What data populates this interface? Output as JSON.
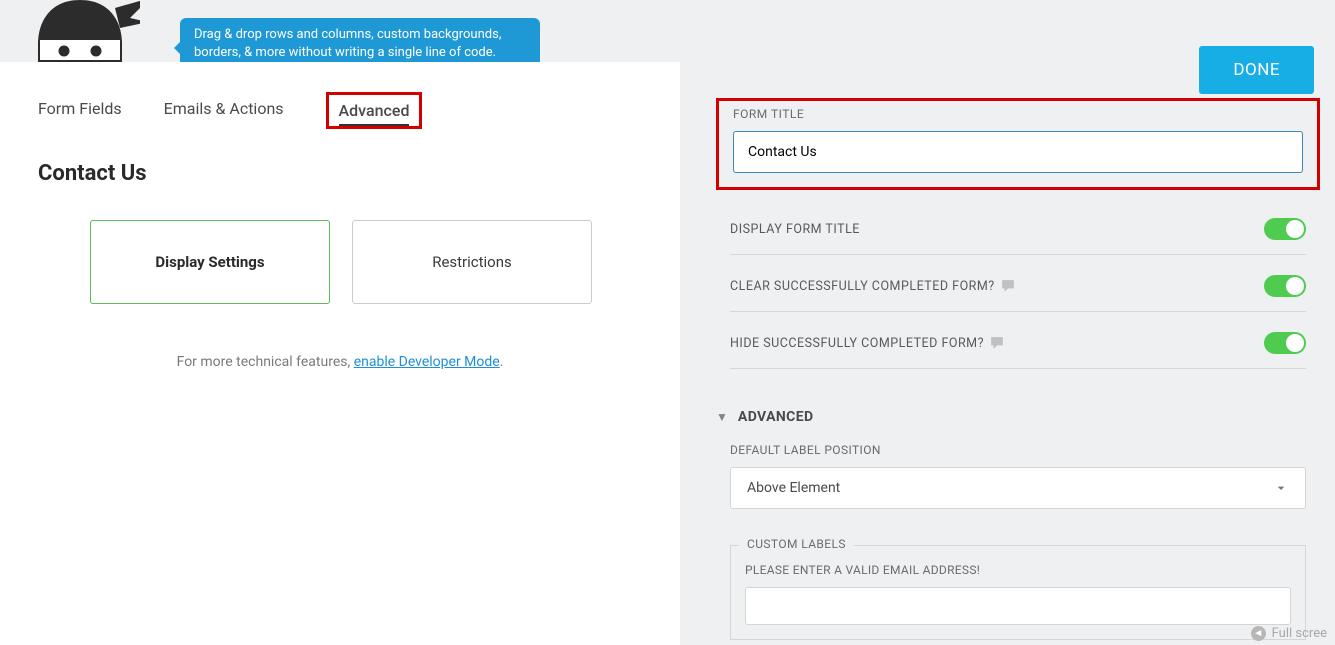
{
  "tooltip": {
    "text": "Drag & drop rows and columns, custom backgrounds, borders, & more without writing a single line of code."
  },
  "tabs": {
    "form_fields": "Form Fields",
    "emails_actions": "Emails & Actions",
    "advanced": "Advanced"
  },
  "form_name": "Contact Us",
  "cards": {
    "display_settings": "Display Settings",
    "restrictions": "Restrictions"
  },
  "more_technical": {
    "prefix": "For more technical features, ",
    "link": "enable Developer Mode",
    "suffix": "."
  },
  "done_button": "DONE",
  "right": {
    "form_title_label": "FORM TITLE",
    "form_title_value": "Contact Us",
    "display_form_title": "DISPLAY FORM TITLE",
    "clear_completed": "CLEAR SUCCESSFULLY COMPLETED FORM?",
    "hide_completed": "HIDE SUCCESSFULLY COMPLETED FORM?",
    "advanced_section": "ADVANCED",
    "default_label_position": "DEFAULT LABEL POSITION",
    "default_label_value": "Above Element",
    "custom_labels": "CUSTOM LABELS",
    "valid_email": "PLEASE ENTER A VALID EMAIL ADDRESS!"
  },
  "full_screen": "Full scree"
}
